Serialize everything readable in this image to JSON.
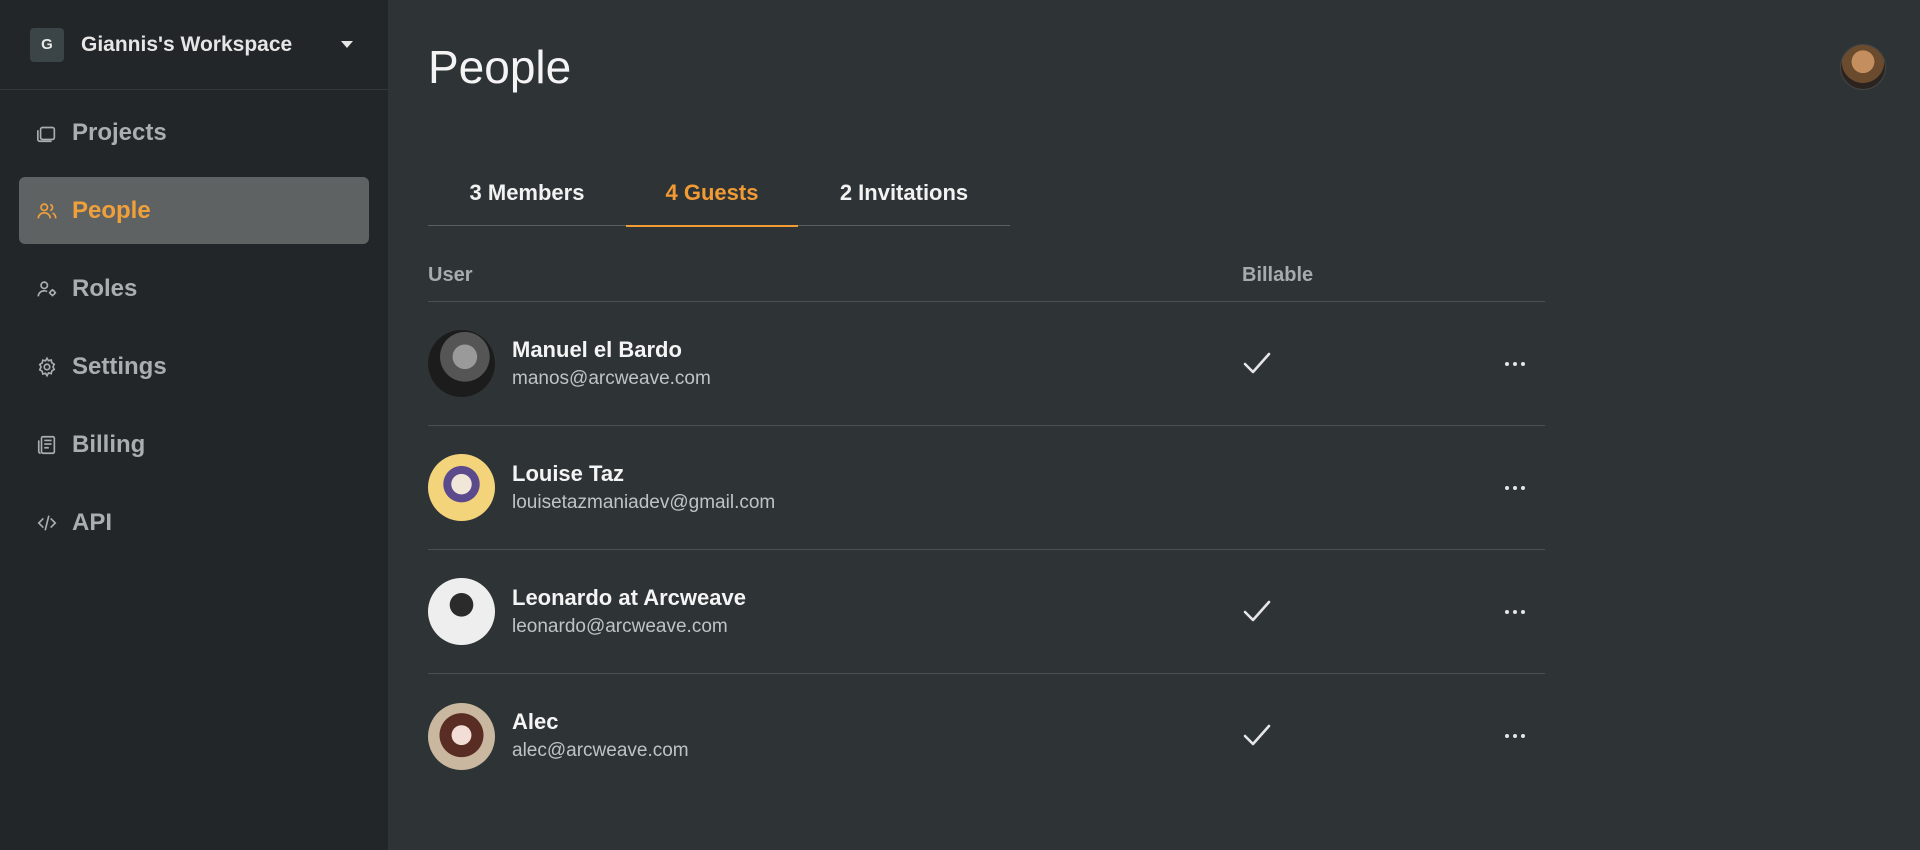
{
  "workspace": {
    "badge": "G",
    "name": "Giannis's Workspace"
  },
  "nav": [
    {
      "label": "Projects",
      "icon": "folders-icon",
      "active": false
    },
    {
      "label": "People",
      "icon": "people-icon",
      "active": true
    },
    {
      "label": "Roles",
      "icon": "user-roles-icon",
      "active": false
    },
    {
      "label": "Settings",
      "icon": "gear-icon",
      "active": false
    },
    {
      "label": "Billing",
      "icon": "receipt-icon",
      "active": false
    },
    {
      "label": "API",
      "icon": "code-icon",
      "active": false
    }
  ],
  "page": {
    "title": "People"
  },
  "tabs": [
    {
      "label": "3 Members"
    },
    {
      "label": "4 Guests"
    },
    {
      "label": "2 Invitations"
    }
  ],
  "colors": {
    "accent": "#f29a34",
    "sidebar_bg": "#222628",
    "main_bg": "#2e3436",
    "active_nav_bg": "#5f6263"
  },
  "table": {
    "headers": {
      "user": "User",
      "billable": "Billable"
    },
    "rows": [
      {
        "name": "Manuel el Bardo",
        "email": "manos@arcweave.com",
        "billable": true
      },
      {
        "name": "Louise Taz",
        "email": "louisetazmaniadev@gmail.com",
        "billable": false
      },
      {
        "name": "Leonardo at Arcweave",
        "email": "leonardo@arcweave.com",
        "billable": true
      },
      {
        "name": "Alec",
        "email": "alec@arcweave.com",
        "billable": true
      }
    ]
  }
}
